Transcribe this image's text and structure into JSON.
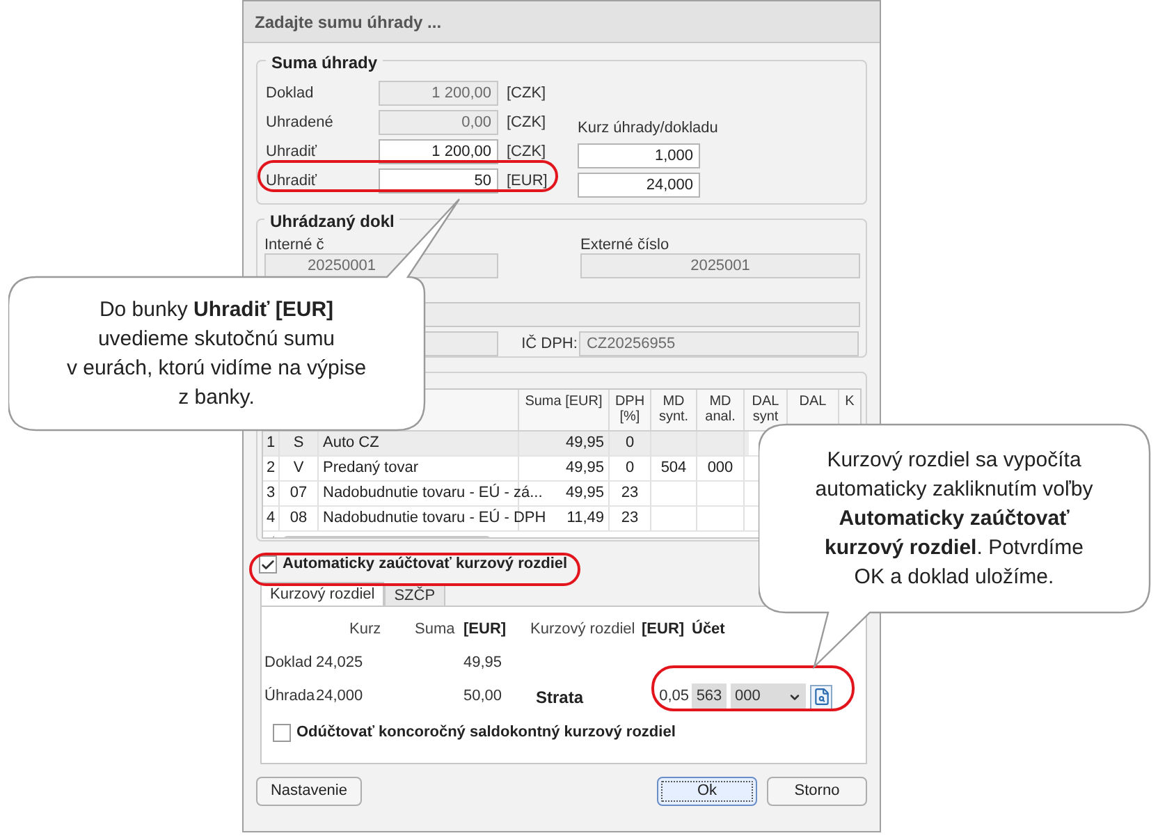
{
  "window": {
    "title": "Zadajte sumu úhrady ..."
  },
  "suma_uhrady": {
    "title": "Suma úhrady",
    "rows": [
      {
        "label": "Doklad",
        "value": "1 200,00",
        "unit": "[CZK]",
        "disabled": true
      },
      {
        "label": "Uhradené",
        "value": "0,00",
        "unit": "[CZK]",
        "disabled": true
      },
      {
        "label": "Uhradiť",
        "value": "1 200,00",
        "unit": "[CZK]",
        "disabled": false
      },
      {
        "label": "Uhradiť",
        "value": "50",
        "unit": "[EUR]",
        "disabled": false
      }
    ],
    "rate_label": "Kurz úhrady/dokladu",
    "rates": [
      "1,000",
      "24,000"
    ]
  },
  "uhradzany_doklad": {
    "title": "Uhrádzaný dokl",
    "internal_label": "Interné č",
    "internal_value": "20250001",
    "external_label": "Externé číslo",
    "external_value": "2025001",
    "vat_label": "IČ DPH:",
    "vat_value": "CZ20256955"
  },
  "table": {
    "columns": [
      "",
      "",
      "",
      "Suma [EUR]",
      "DPH [%]",
      "MD synt.",
      "MD anal.",
      "DAL synt",
      "DAL",
      "K"
    ],
    "rows": [
      {
        "cells": [
          "1",
          "S",
          "Auto CZ",
          "49,95",
          "0",
          "",
          ""
        ],
        "selected": true
      },
      {
        "cells": [
          "2",
          "V",
          "Predaný tovar",
          "49,95",
          "0",
          "504",
          "000"
        ],
        "selected": false
      },
      {
        "cells": [
          "3",
          "07",
          "Nadobudnutie tovaru - EÚ - zá...",
          "49,95",
          "23",
          "",
          ""
        ],
        "selected": false
      },
      {
        "cells": [
          "4",
          "08",
          "Nadobudnutie tovaru - EÚ - DPH",
          "11,49",
          "23",
          "",
          ""
        ],
        "selected": false
      }
    ]
  },
  "auto_checkbox": {
    "label": "Automaticky zaúčtovať kurzový rozdiel",
    "checked": true
  },
  "tabs": [
    {
      "label": "Kurzový rozdiel",
      "selected": true
    },
    {
      "label": "SZČP",
      "selected": false
    }
  ],
  "exchange": {
    "headers": [
      "Kurz",
      "Suma",
      "[EUR]",
      "Kurzový rozdiel",
      "[EUR]",
      "Účet"
    ],
    "rows": [
      {
        "label": "Doklad",
        "rate": "24,025",
        "amount": "49,95"
      },
      {
        "label": "Úhrada",
        "rate": "24,000",
        "amount": "50,00"
      }
    ],
    "result": "Strata",
    "difference": "0,05",
    "account": "563",
    "analytic": "000"
  },
  "year_end_checkbox": {
    "label": "Odúčtovať koncoročný saldokontný kurzový rozdiel",
    "checked": false
  },
  "buttons": [
    {
      "label": "Nastavenie",
      "default": false
    },
    {
      "label": "Ok",
      "default": true
    },
    {
      "label": "Storno",
      "default": false
    }
  ],
  "callouts": [
    {
      "text": "Do bunky **Uhradiť [EUR]**\nuvedieme skutočnú sumu\nv eurách, ktorú vidíme na výpise\nz banky."
    },
    {
      "text": "Kurzový rozdiel sa vypočíta\nautomaticky zakliknutím voľby\n**Automaticky zaúčtovať\nkurzový rozdiel**. Potvrdíme\nOK a doklad uložíme."
    }
  ]
}
